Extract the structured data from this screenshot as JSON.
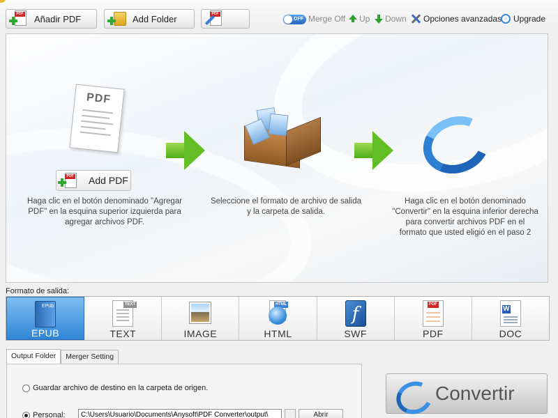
{
  "toolbar": {
    "add_pdf_label": "Añadir PDF",
    "add_folder_label": "Add Folder",
    "pdf_badge": "PDF",
    "merge_toggle": "OFF",
    "merge_label": "Merge Off",
    "up_label": "Up",
    "down_label": "Down",
    "advanced_label": "Opciones avanzadas",
    "upgrade_label": "Upgrade"
  },
  "guide": {
    "step1_button": "Add PDF",
    "step1_paper": "PDF",
    "step1_text": "Haga clic en el botón denominado \"Agregar PDF\" en la esquina superior izquierda para agregar archivos PDF.",
    "step2_text": "Seleccione el formato de archivo de salida y la carpeta de salida.",
    "step3_text": "Haga clic en el botón denominado \"Convertir\" en la esquina inferior derecha para convertir archivos PDF en el formato que usted eligió en el paso 2"
  },
  "output": {
    "label": "Formato de salida:",
    "formats": [
      {
        "label": "EPUB",
        "icon": "epub-book-icon",
        "selected": true
      },
      {
        "label": "TEXT",
        "icon": "text-file-icon",
        "tag": "TEXT",
        "selected": false
      },
      {
        "label": "IMAGE",
        "icon": "image-file-icon",
        "selected": false
      },
      {
        "label": "HTML",
        "icon": "html-globe-icon",
        "tag": "HTML",
        "selected": false
      },
      {
        "label": "SWF",
        "icon": "flash-icon",
        "selected": false
      },
      {
        "label": "PDF",
        "icon": "pdf-file-icon",
        "tag": "PDF",
        "selected": false
      },
      {
        "label": "DOC",
        "icon": "word-doc-icon",
        "selected": false
      }
    ]
  },
  "settings": {
    "tabs": [
      "Output Folder",
      "Merger Setting"
    ],
    "active_tab": 0,
    "option_source": "Guardar archivo de destino en la carpeta de origen.",
    "option_custom": "Personal:",
    "path_value": "C:\\Users\\Usuario\\Documents\\Anysoft\\PDF Converter\\output\\",
    "open_button": "Abrir"
  },
  "convert": {
    "label": "Convertir"
  },
  "colors": {
    "accent": "#2f86d6",
    "green_arrow": "#62be24",
    "pdf_red": "#d02525"
  }
}
